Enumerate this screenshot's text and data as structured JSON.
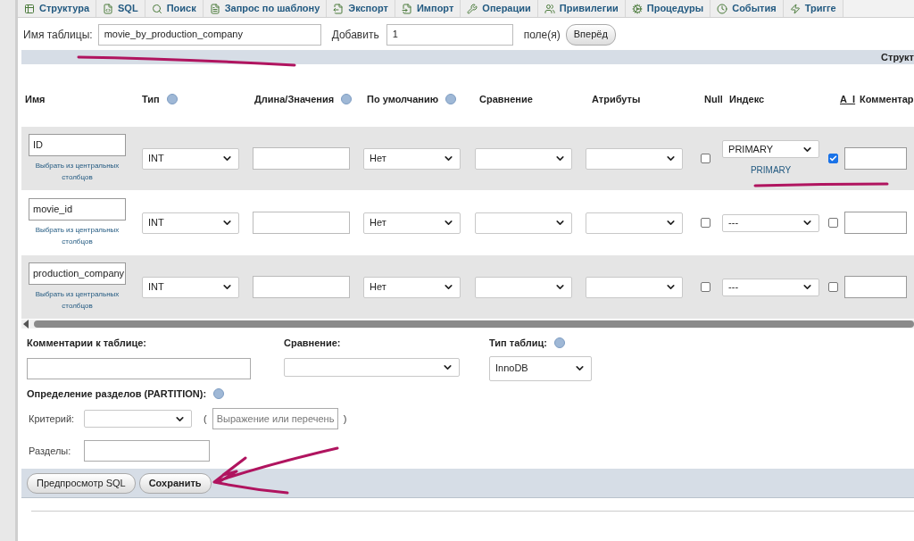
{
  "tabs": [
    {
      "label": "Структура",
      "selected": false
    },
    {
      "label": "SQL",
      "selected": false
    },
    {
      "label": "Поиск",
      "selected": false
    },
    {
      "label": "Запрос по шаблону",
      "selected": false
    },
    {
      "label": "Экспорт",
      "selected": false
    },
    {
      "label": "Импорт",
      "selected": false
    },
    {
      "label": "Операции",
      "selected": false
    },
    {
      "label": "Привилегии",
      "selected": false
    },
    {
      "label": "Процедуры",
      "selected": false
    },
    {
      "label": "События",
      "selected": false
    },
    {
      "label": "Тригге",
      "selected": false
    }
  ],
  "table_name": {
    "label": "Имя таблицы:",
    "value": "movie_by_production_company"
  },
  "add": {
    "label": "Добавить",
    "value": "1",
    "unit": "поле(я)",
    "button": "Вперёд"
  },
  "section_bar": "Структ",
  "columns": [
    {
      "label": "Имя"
    },
    {
      "label": "Тип",
      "help": true
    },
    {
      "label": "Длина/Значения",
      "help": true
    },
    {
      "label": "По умолчанию",
      "help": true
    },
    {
      "label": "Сравнение"
    },
    {
      "label": "Атрибуты"
    },
    {
      "label": "Null"
    },
    {
      "label": "Индекс"
    },
    {
      "label": "A_I"
    },
    {
      "label": "Комментар"
    }
  ],
  "rows": [
    {
      "name": "ID",
      "link": "Выбрать из центральных столбцов",
      "type": "INT",
      "default": "Нет",
      "index": "PRIMARY",
      "index_link": "PRIMARY",
      "null": false,
      "ai": true
    },
    {
      "name": "movie_id",
      "link": "Выбрать из центральных столбцов",
      "type": "INT",
      "default": "Нет",
      "index": "---",
      "null": false,
      "ai": false
    },
    {
      "name": "production_company",
      "link": "Выбрать из центральных столбцов",
      "type": "INT",
      "default": "Нет",
      "index": "---",
      "null": false,
      "ai": false
    }
  ],
  "table_comment": {
    "label": "Комментарии к таблице:"
  },
  "collation": {
    "label": "Сравнение:"
  },
  "engine": {
    "label": "Тип таблиц:",
    "value": "InnoDB"
  },
  "partition": {
    "label": "Определение разделов (PARTITION):",
    "criterion_label": "Критерий:",
    "open_paren": "(",
    "expression_placeholder": "Выражение или перечень",
    "close_paren": ")",
    "partitions_label": "Разделы:"
  },
  "buttons": [
    "Предпросмотр SQL",
    "Сохранить"
  ]
}
